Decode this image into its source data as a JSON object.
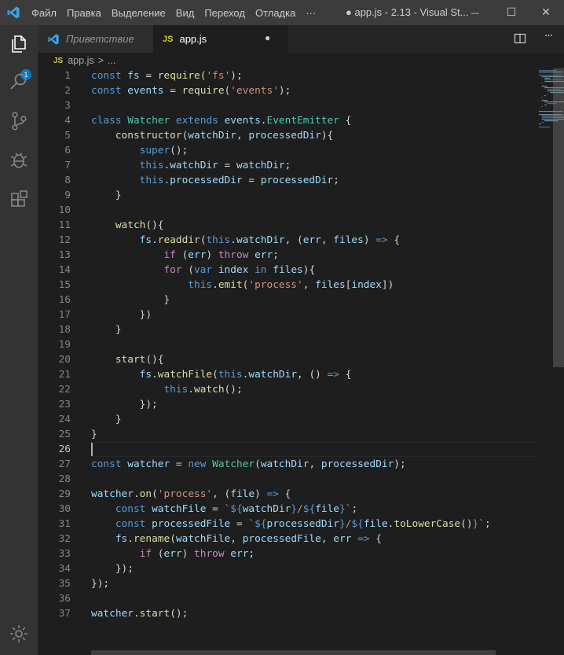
{
  "titlebar": {
    "menu": [
      "Файл",
      "Правка",
      "Выделение",
      "Вид",
      "Переход",
      "Отладка",
      "···"
    ],
    "title": "● app.js - 2.13 - Visual St...",
    "minimize_glyph": "—",
    "maximize_glyph": "☐",
    "close_glyph": "✕"
  },
  "activity": {
    "badge": "1"
  },
  "tabs": [
    {
      "label": "Приветствие",
      "icon": "vscode-icon"
    },
    {
      "label": "app.js",
      "icon": "js-icon",
      "dirty_glyph": "●"
    }
  ],
  "breadcrumbs": {
    "file": "app.js",
    "separator": ">",
    "more": "..."
  },
  "editor": {
    "active_line": 26,
    "line_numbers": [
      "1",
      "2",
      "3",
      "4",
      "5",
      "6",
      "7",
      "8",
      "9",
      "10",
      "11",
      "12",
      "13",
      "14",
      "15",
      "16",
      "17",
      "18",
      "19",
      "20",
      "21",
      "22",
      "23",
      "24",
      "25",
      "26",
      "27",
      "28",
      "29",
      "30",
      "31",
      "32",
      "33",
      "34",
      "35",
      "36",
      "37"
    ],
    "lines": [
      "const fs = require('fs');",
      "const events = require('events');",
      "",
      "class Watcher extends events.EventEmitter {",
      "    constructor(watchDir, processedDir){",
      "        super();",
      "        this.watchDir = watchDir;",
      "        this.processedDir = processedDir;",
      "    }",
      "",
      "    watch(){",
      "        fs.readdir(this.watchDir, (err, files) => {",
      "            if (err) throw err;",
      "            for (var index in files){",
      "                this.emit('process', files[index])",
      "            }",
      "        })",
      "    }",
      "",
      "    start(){",
      "        fs.watchFile(this.watchDir, () => {",
      "            this.watch();",
      "        });",
      "    }",
      "}",
      "",
      "const watcher = new Watcher(watchDir, processedDir);",
      "",
      "watcher.on('process', (file) => {",
      "    const watchFile = `${watchDir}/${file}`;",
      "    const processedFile = `${processedDir}/${file.toLowerCase()}`;",
      "    fs.rename(watchFile, processedFile, err => {",
      "        if (err) throw err;",
      "    });",
      "});",
      "",
      "watcher.start();"
    ]
  },
  "colors": {
    "keyword": "#569cd6",
    "control": "#c586c0",
    "variable": "#9cdcfe",
    "function": "#dcdcaa",
    "string": "#ce9178",
    "class": "#4ec9b0",
    "text": "#d4d4d4"
  }
}
